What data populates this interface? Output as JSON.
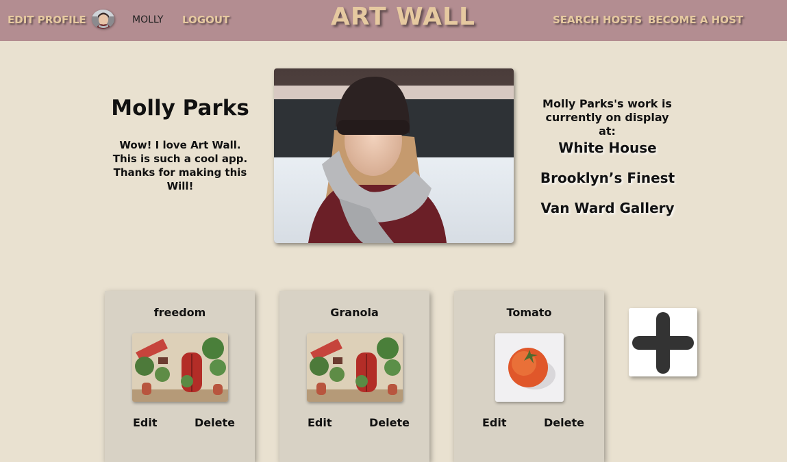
{
  "nav": {
    "edit_profile": "EDIT PROFILE",
    "username": "MOLLY",
    "logout": "LOGOUT",
    "brand": "ART WALL",
    "search_hosts": "SEARCH HOSTS",
    "become_host": "BECOME A HOST"
  },
  "profile": {
    "name": "Molly Parks",
    "bio": "Wow! I love Art Wall. This is such a cool app. Thanks for making this Will!",
    "display_heading": "Molly Parks's work is currently on display at:",
    "venues": [
      "White House",
      "Brooklyn’s Finest",
      "Van Ward Gallery"
    ]
  },
  "artworks": [
    {
      "title": "freedom",
      "edit": "Edit",
      "delete": "Delete"
    },
    {
      "title": "Granola",
      "edit": "Edit",
      "delete": "Delete"
    },
    {
      "title": "Tomato",
      "edit": "Edit",
      "delete": "Delete"
    }
  ],
  "icons": {
    "add": "plus-icon",
    "avatar": "avatar"
  },
  "colors": {
    "nav_bg": "#b38d91",
    "nav_text": "#e6c9a0",
    "page_bg": "#e9e1d0",
    "card_bg": "#d8d2c5"
  }
}
